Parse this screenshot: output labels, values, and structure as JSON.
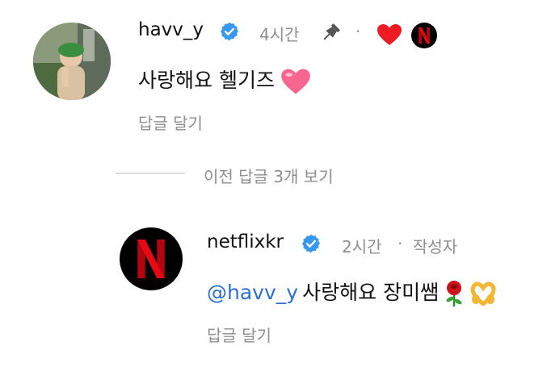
{
  "comment": {
    "username": "havv_y",
    "time": "4시간",
    "text": "사랑해요 헬기즈",
    "reply_label": "답글 달기",
    "liked_by_author_logo": "N"
  },
  "thread": {
    "view_previous": "이전 답글 3개 보기"
  },
  "reply": {
    "username": "netflixkr",
    "time": "2시간",
    "author_tag": "작성자",
    "mention": "@havv_y",
    "text": "사랑해요 장미쌤",
    "reply_label": "답글 달기",
    "logo": "N"
  },
  "colors": {
    "verified": "#3897f0",
    "heart": "#ed1c24",
    "mention": "#2b6fd6",
    "netflix_red": "#e50914",
    "muted": "#8e8e8e"
  },
  "icons": [
    "verified-badge-icon",
    "pin-icon",
    "heart-icon",
    "pink-heart-emoji",
    "rose-emoji",
    "heart-hands-emoji"
  ]
}
